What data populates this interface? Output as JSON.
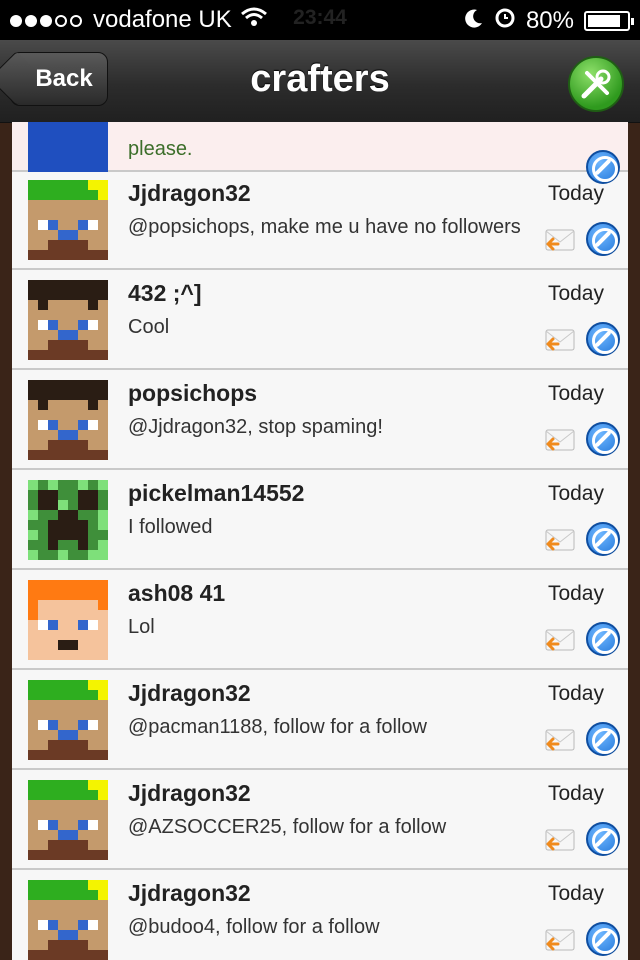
{
  "status": {
    "carrier": "vodafone UK",
    "time": "23:44",
    "battery": "80%"
  },
  "nav": {
    "back_label": "Back",
    "title": "crafters"
  },
  "top_row": {
    "message": "please."
  },
  "rows": [
    {
      "name": "Jjdragon32",
      "time": "Today",
      "message": "@popsichops, make me u have no followers",
      "avatar": "green"
    },
    {
      "name": "432 ;^]",
      "time": "Today",
      "message": "Cool",
      "avatar": "steve"
    },
    {
      "name": "popsichops",
      "time": "Today",
      "message": "@Jjdragon32, stop spaming!",
      "avatar": "steve"
    },
    {
      "name": "pickelman14552",
      "time": "Today",
      "message": "I followed",
      "avatar": "creeper"
    },
    {
      "name": "ash08 41",
      "time": "Today",
      "message": "Lol",
      "avatar": "orange"
    },
    {
      "name": "Jjdragon32",
      "time": "Today",
      "message": "@pacman1188, follow for a follow",
      "avatar": "green"
    },
    {
      "name": "Jjdragon32",
      "time": "Today",
      "message": "@AZSOCCER25, follow for a follow",
      "avatar": "green"
    },
    {
      "name": "Jjdragon32",
      "time": "Today",
      "message": "@budoo4, follow for a follow",
      "avatar": "green"
    }
  ]
}
